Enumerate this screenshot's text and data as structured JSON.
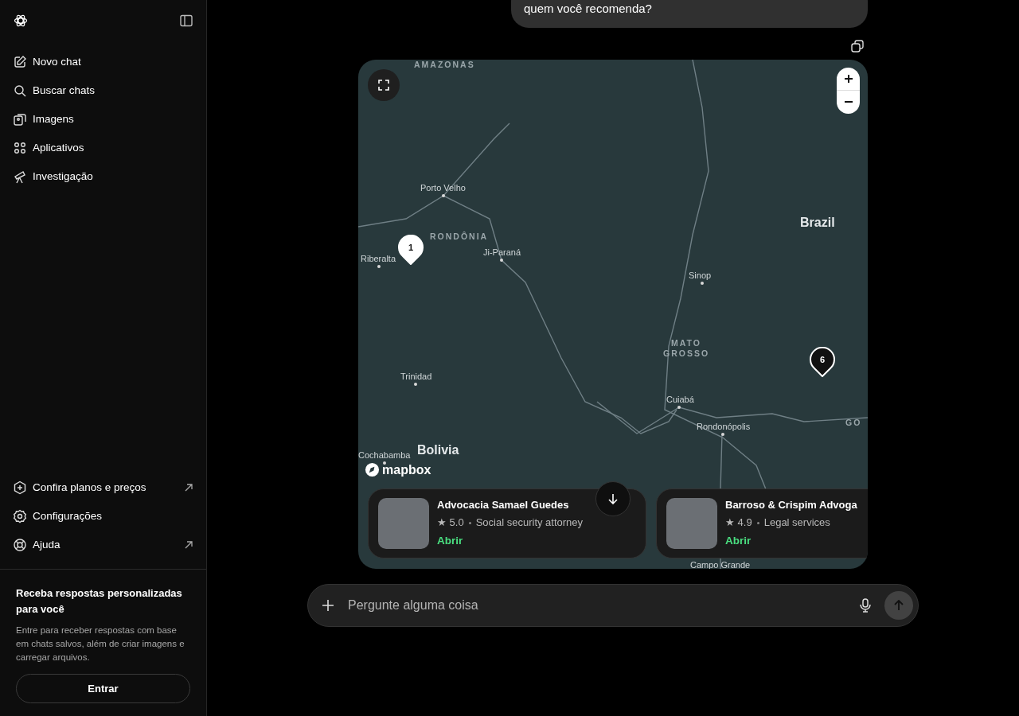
{
  "sidebar": {
    "items": [
      {
        "label": "Novo chat"
      },
      {
        "label": "Buscar chats"
      },
      {
        "label": "Imagens"
      },
      {
        "label": "Aplicativos"
      },
      {
        "label": "Investigação"
      }
    ],
    "footer_items": [
      {
        "label": "Confira planos e preços",
        "external": true
      },
      {
        "label": "Configurações",
        "external": false
      },
      {
        "label": "Ajuda",
        "external": true
      }
    ],
    "promo": {
      "title": "Receba respostas personalizadas para você",
      "text": "Entre para receber respostas com base em chats salvos, além de criar imagens e carregar arquivos.",
      "button": "Entrar"
    }
  },
  "message": {
    "text": "quem você recomenda?"
  },
  "map": {
    "labels": [
      {
        "text": "AMAZONAS",
        "kind": "region"
      },
      {
        "text": "Porto Velho",
        "kind": "city"
      },
      {
        "text": "RONDÔNIA",
        "kind": "region"
      },
      {
        "text": "Ji-Paraná",
        "kind": "city"
      },
      {
        "text": "Riberalta",
        "kind": "city"
      },
      {
        "text": "Brazil",
        "kind": "country"
      },
      {
        "text": "Sinop",
        "kind": "city"
      },
      {
        "text": "MATO GROSSO",
        "kind": "region"
      },
      {
        "text": "Trinidad",
        "kind": "city"
      },
      {
        "text": "Cuiabá",
        "kind": "city"
      },
      {
        "text": "Rondonópolis",
        "kind": "city"
      },
      {
        "text": "GO",
        "kind": "region"
      },
      {
        "text": "Bolivia",
        "kind": "country"
      },
      {
        "text": "Cochabamba",
        "kind": "city"
      },
      {
        "text": "Campo Grande",
        "kind": "city"
      }
    ],
    "markers": [
      {
        "label": "1",
        "selected": true
      },
      {
        "label": "6",
        "selected": false
      }
    ],
    "attribution": "mapbox",
    "cards": [
      {
        "name": "Advocacia Samael Guedes",
        "rating": "★ 5.0",
        "category": "Social security attorney",
        "action": "Abrir"
      },
      {
        "name": "Barroso & Crispim Advoga",
        "rating": "★ 4.9",
        "category": "Legal services",
        "action": "Abrir"
      }
    ]
  },
  "composer": {
    "placeholder": "Pergunte alguma coisa"
  }
}
